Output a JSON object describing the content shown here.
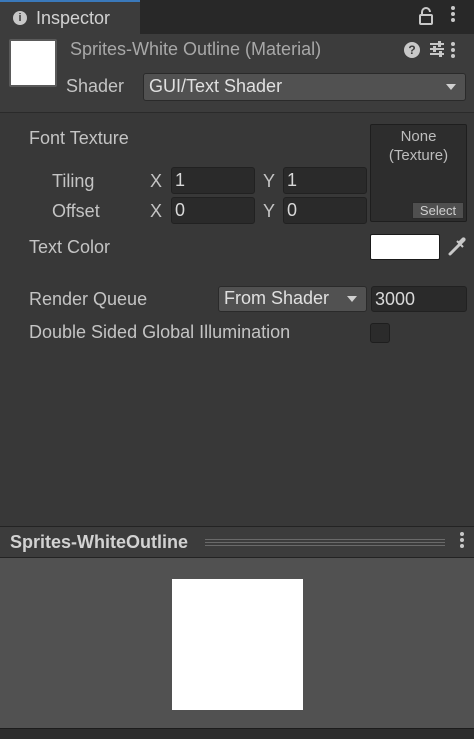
{
  "tab": {
    "title": "Inspector"
  },
  "material": {
    "title": "Sprites-White Outline (Material)",
    "shader_label": "Shader",
    "shader_value": "GUI/Text Shader",
    "thumb_color": "#ffffff"
  },
  "properties": {
    "font_texture": {
      "label": "Font Texture",
      "slot_text_line1": "None",
      "slot_text_line2": "(Texture)",
      "select_label": "Select",
      "tiling": {
        "label": "Tiling",
        "x_label": "X",
        "x": "1",
        "y_label": "Y",
        "y": "1"
      },
      "offset": {
        "label": "Offset",
        "x_label": "X",
        "x": "0",
        "y_label": "Y",
        "y": "0"
      }
    },
    "text_color": {
      "label": "Text Color",
      "color": "#ffffff"
    },
    "render_queue": {
      "label": "Render Queue",
      "mode": "From Shader",
      "value": "3000"
    },
    "double_sided_gi": {
      "label": "Double Sided Global Illumination",
      "checked": false
    }
  },
  "preview": {
    "title": "Sprites-WhiteOutline",
    "quad_color": "#ffffff"
  },
  "icons": [
    "info-icon",
    "lock-icon",
    "kebab-menu-icon",
    "help-icon",
    "preset-sliders-icon",
    "dropdown-arrow-icon",
    "eyedropper-icon"
  ]
}
